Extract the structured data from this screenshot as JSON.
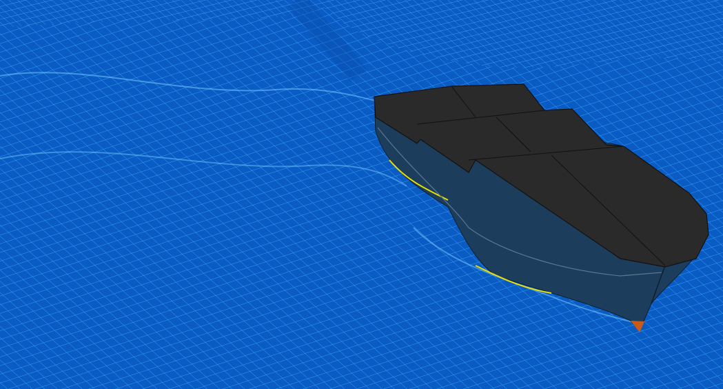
{
  "scene": {
    "colors": {
      "water": "#0a5cc4",
      "water_dark": "#0848a8",
      "mesh_line": "#3fb4ff",
      "deck": "#2a2a2a",
      "deck_edge": "#111111",
      "hull": "#1d3d5c",
      "hull_line": "#5a7890",
      "waterline": "#e8e000",
      "keel": "#c85a1a"
    }
  }
}
